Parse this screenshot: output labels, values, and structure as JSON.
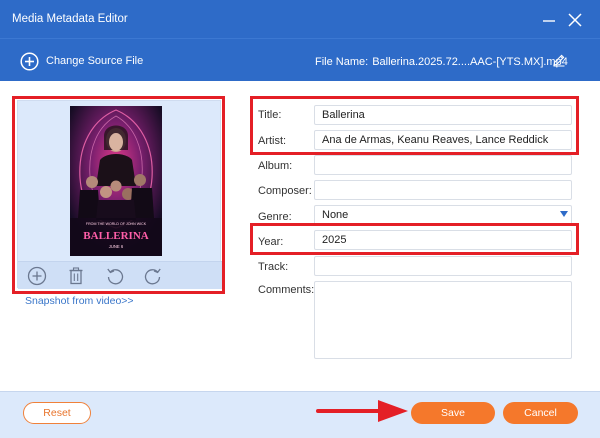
{
  "window": {
    "title": "Media Metadata Editor"
  },
  "toolbar": {
    "change_source_label": "Change Source File",
    "file_name_label": "File Name:",
    "file_name_value": "Ballerina.2025.72....AAC-[YTS.MX].mp4"
  },
  "cover": {
    "snapshot_link": "Snapshot from video>>",
    "poster_tagline": "FROM THE WORLD OF JOHN WICK",
    "poster_title": "BALLERINA",
    "poster_date": "JUNE 6"
  },
  "fields": {
    "title": {
      "label": "Title:",
      "value": "Ballerina"
    },
    "artist": {
      "label": "Artist:",
      "value": "Ana de Armas, Keanu Reaves, Lance Reddick"
    },
    "album": {
      "label": "Album:",
      "value": ""
    },
    "composer": {
      "label": "Composer:",
      "value": ""
    },
    "genre": {
      "label": "Genre:",
      "value": "None"
    },
    "year": {
      "label": "Year:",
      "value": "2025"
    },
    "track": {
      "label": "Track:",
      "value": ""
    },
    "comments": {
      "label": "Comments:",
      "value": ""
    }
  },
  "footer": {
    "reset_label": "Reset",
    "save_label": "Save",
    "cancel_label": "Cancel"
  },
  "colors": {
    "title_bar": "#2e6bc8",
    "accent_orange": "#f5782b",
    "highlight_red": "#e41f26",
    "panel_blue": "#dce9fb"
  }
}
